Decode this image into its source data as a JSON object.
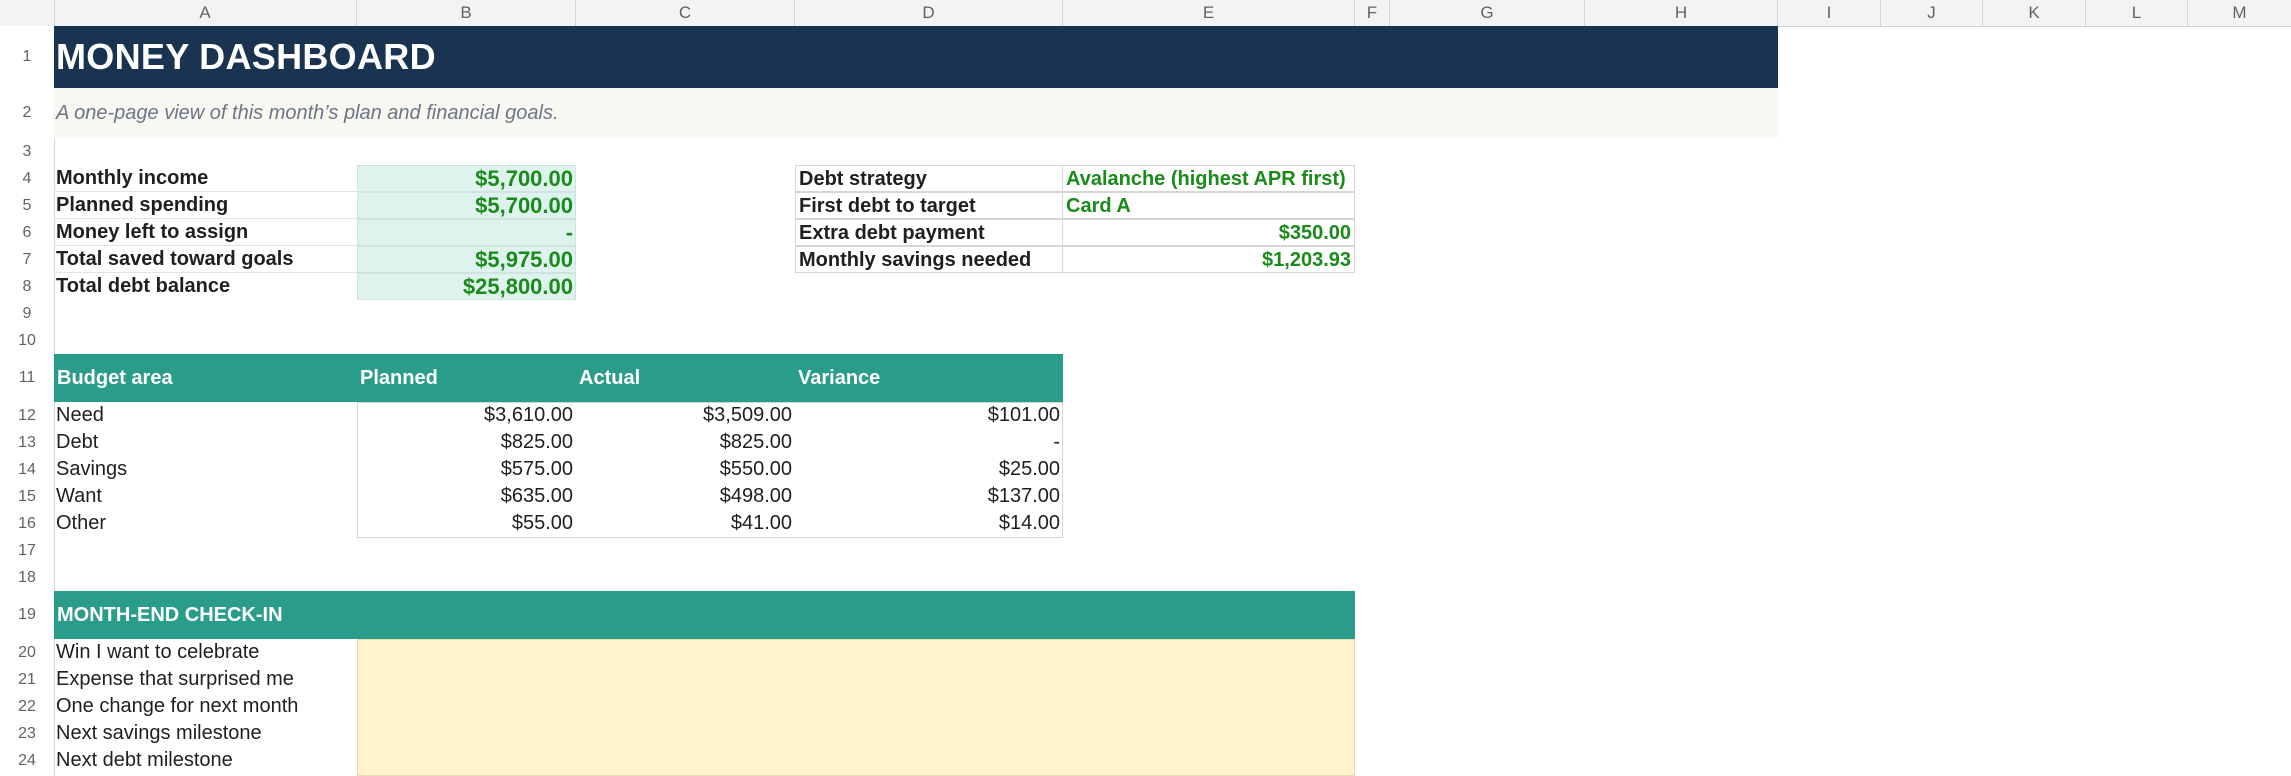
{
  "columns": [
    "A",
    "B",
    "C",
    "D",
    "E",
    "F",
    "G",
    "H",
    "I",
    "J",
    "K",
    "L",
    "M"
  ],
  "rows": [
    "1",
    "2",
    "3",
    "4",
    "5",
    "6",
    "7",
    "8",
    "9",
    "10",
    "11",
    "12",
    "13",
    "14",
    "15",
    "16",
    "17",
    "18",
    "19",
    "20",
    "21",
    "22",
    "23",
    "24"
  ],
  "title": "MONEY DASHBOARD",
  "subtitle": "A one-page view of this month’s plan and financial goals.",
  "summary": [
    {
      "label": "Monthly income",
      "value": "$5,700.00"
    },
    {
      "label": "Planned spending",
      "value": "$5,700.00"
    },
    {
      "label": "Money left to assign",
      "value": "-"
    },
    {
      "label": "Total saved toward goals",
      "value": "$5,975.00"
    },
    {
      "label": "Total debt balance",
      "value": "$25,800.00"
    }
  ],
  "debt": [
    {
      "label": "Debt strategy",
      "value": "Avalanche (highest APR first)"
    },
    {
      "label": "First debt to target",
      "value": "Card A"
    },
    {
      "label": "Extra debt payment",
      "value": "$350.00"
    },
    {
      "label": "Monthly savings needed",
      "value": "$1,203.93"
    }
  ],
  "budget": {
    "headers": [
      "Budget area",
      "Planned",
      "Actual",
      "Variance"
    ],
    "rows": [
      {
        "area": "Need",
        "planned": "$3,610.00",
        "actual": "$3,509.00",
        "variance": "$101.00"
      },
      {
        "area": "Debt",
        "planned": "$825.00",
        "actual": "$825.00",
        "variance": "-"
      },
      {
        "area": "Savings",
        "planned": "$575.00",
        "actual": "$550.00",
        "variance": "$25.00"
      },
      {
        "area": "Want",
        "planned": "$635.00",
        "actual": "$498.00",
        "variance": "$137.00"
      },
      {
        "area": "Other",
        "planned": "$55.00",
        "actual": "$41.00",
        "variance": "$14.00"
      }
    ]
  },
  "checkin": {
    "title": "MONTH-END CHECK-IN",
    "items": [
      "Win I want to celebrate",
      "Expense that surprised me",
      "One change for next month",
      "Next savings milestone",
      "Next debt milestone"
    ]
  },
  "colors": {
    "title_band": "#1a3350",
    "teal": "#2a9d8a",
    "value_green": "#1a8a1a",
    "kpi_fill": "#dff3ee",
    "notes_fill": "#fff4cc"
  }
}
